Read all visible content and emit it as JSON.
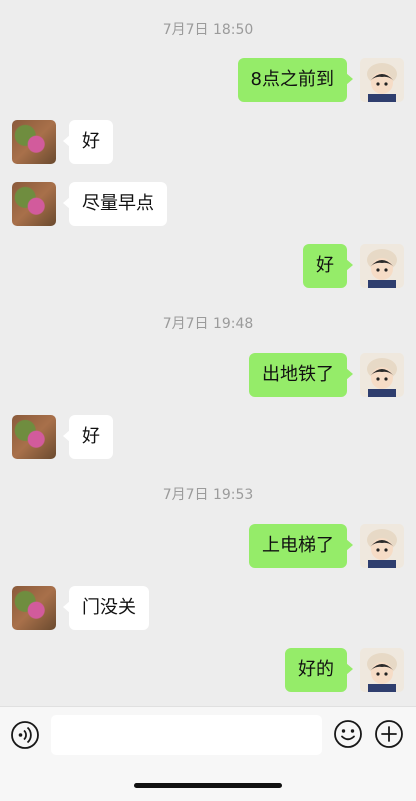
{
  "messages": [
    {
      "type": "time",
      "text": "7月7日 18:50"
    },
    {
      "type": "msg",
      "side": "right",
      "text": "8点之前到",
      "avatar": "baby-avatar"
    },
    {
      "type": "msg",
      "side": "left",
      "text": "好",
      "avatar": "flower-avatar"
    },
    {
      "type": "msg",
      "side": "left",
      "text": "尽量早点",
      "avatar": "flower-avatar"
    },
    {
      "type": "msg",
      "side": "right",
      "text": "好",
      "avatar": "baby-avatar"
    },
    {
      "type": "time",
      "text": "7月7日 19:48"
    },
    {
      "type": "msg",
      "side": "right",
      "text": "出地铁了",
      "avatar": "baby-avatar"
    },
    {
      "type": "msg",
      "side": "left",
      "text": "好",
      "avatar": "flower-avatar"
    },
    {
      "type": "time",
      "text": "7月7日 19:53"
    },
    {
      "type": "msg",
      "side": "right",
      "text": "上电梯了",
      "avatar": "baby-avatar"
    },
    {
      "type": "msg",
      "side": "left",
      "text": "门没关",
      "avatar": "flower-avatar"
    },
    {
      "type": "msg",
      "side": "right",
      "text": "好的",
      "avatar": "baby-avatar"
    }
  ],
  "input_bar": {
    "value": "",
    "voice_icon": "voice-icon",
    "emoji_icon": "emoji-icon",
    "plus_icon": "plus-icon"
  },
  "colors": {
    "background": "#ededed",
    "sent_bubble": "#95ec69",
    "received_bubble": "#ffffff",
    "timestamp": "#9b9b9b"
  }
}
